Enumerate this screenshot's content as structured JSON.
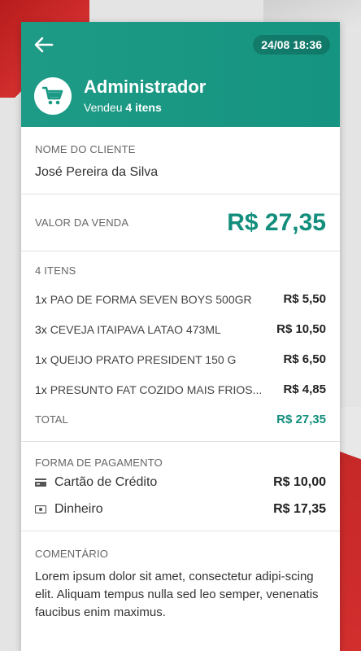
{
  "header": {
    "datetime": "24/08 18:36",
    "user_name": "Administrador",
    "subtitle_prefix": "Vendeu",
    "subtitle_count": "4 itens"
  },
  "client": {
    "label": "NOME DO CLIENTE",
    "name": "José Pereira da Silva"
  },
  "sale": {
    "label": "VALOR DA VENDA",
    "amount": "R$ 27,35"
  },
  "items": {
    "count_label": "4 ITENS",
    "rows": [
      {
        "qty": "1x",
        "name": "PAO DE FORMA SEVEN BOYS 500GR",
        "price": "R$ 5,50"
      },
      {
        "qty": "3x",
        "name": "CEVEJA ITAIPAVA LATAO  473ML",
        "price": "R$ 10,50"
      },
      {
        "qty": "1x",
        "name": "QUEIJO PRATO PRESIDENT 150 G",
        "price": "R$ 6,50"
      },
      {
        "qty": "1x",
        "name": "PRESUNTO FAT COZIDO MAIS FRIOS...",
        "price": "R$ 4,85"
      }
    ],
    "total_label": "TOTAL",
    "total_value": "R$ 27,35"
  },
  "payment": {
    "label": "FORMA DE PAGAMENTO",
    "methods": [
      {
        "icon": "credit-card-icon",
        "name": "Cartão de Crédito",
        "amount": "R$ 10,00"
      },
      {
        "icon": "cash-icon",
        "name": "Dinheiro",
        "amount": "R$ 17,35"
      }
    ]
  },
  "comment": {
    "label": "COMENTÁRIO",
    "text": "Lorem ipsum dolor sit amet, consectetur adipi-scing elit. Aliquam tempus nulla sed leo semper, venenatis faucibus enim maximus."
  },
  "colors": {
    "primary": "#1a9985",
    "accent_text": "#138e7c",
    "background_accent": "#d32f2f"
  }
}
